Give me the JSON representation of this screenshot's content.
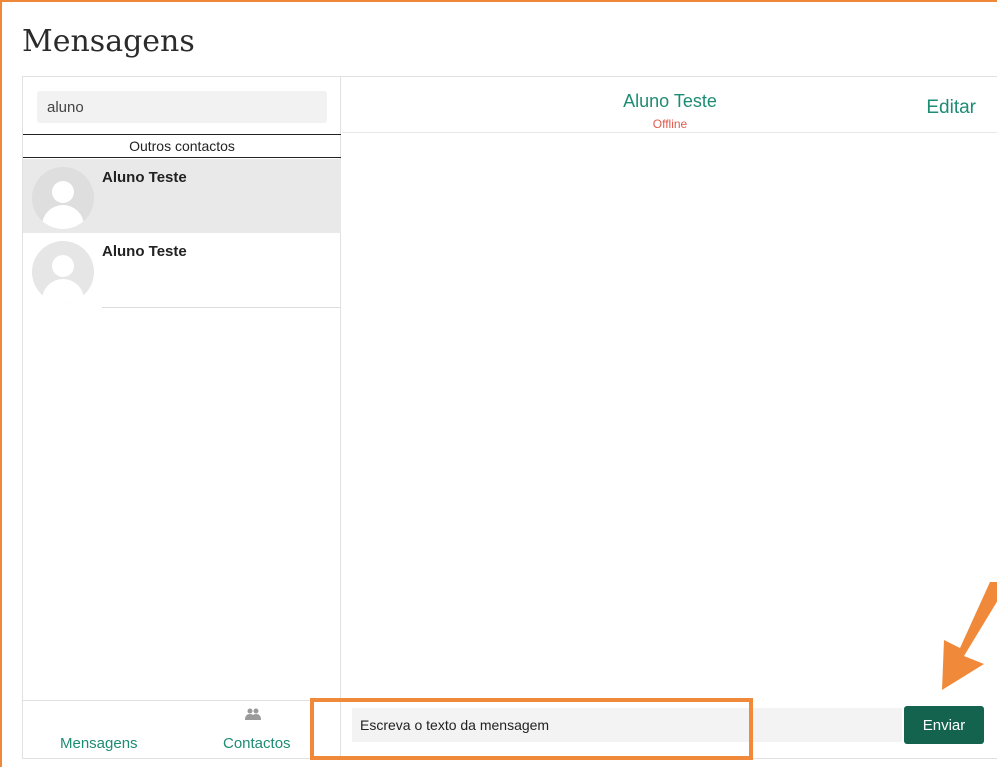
{
  "page": {
    "title": "Mensagens"
  },
  "sidebar": {
    "search_value": "aluno",
    "section_header": "Outros contactos",
    "contacts": [
      {
        "name": "Aluno Teste",
        "selected": true
      },
      {
        "name": "Aluno Teste",
        "selected": false
      }
    ],
    "footer": {
      "messages_label": "Mensagens",
      "contacts_label": "Contactos"
    }
  },
  "conversation": {
    "contact_name": "Aluno Teste",
    "status": "Offline",
    "edit_label": "Editar",
    "composer": {
      "value": "Escreva o texto da mensagem",
      "send_label": "Enviar"
    }
  },
  "colors": {
    "accent": "#1d8c74",
    "send_button": "#14634f",
    "offline": "#e05a4f",
    "highlight": "#f08a3a"
  }
}
